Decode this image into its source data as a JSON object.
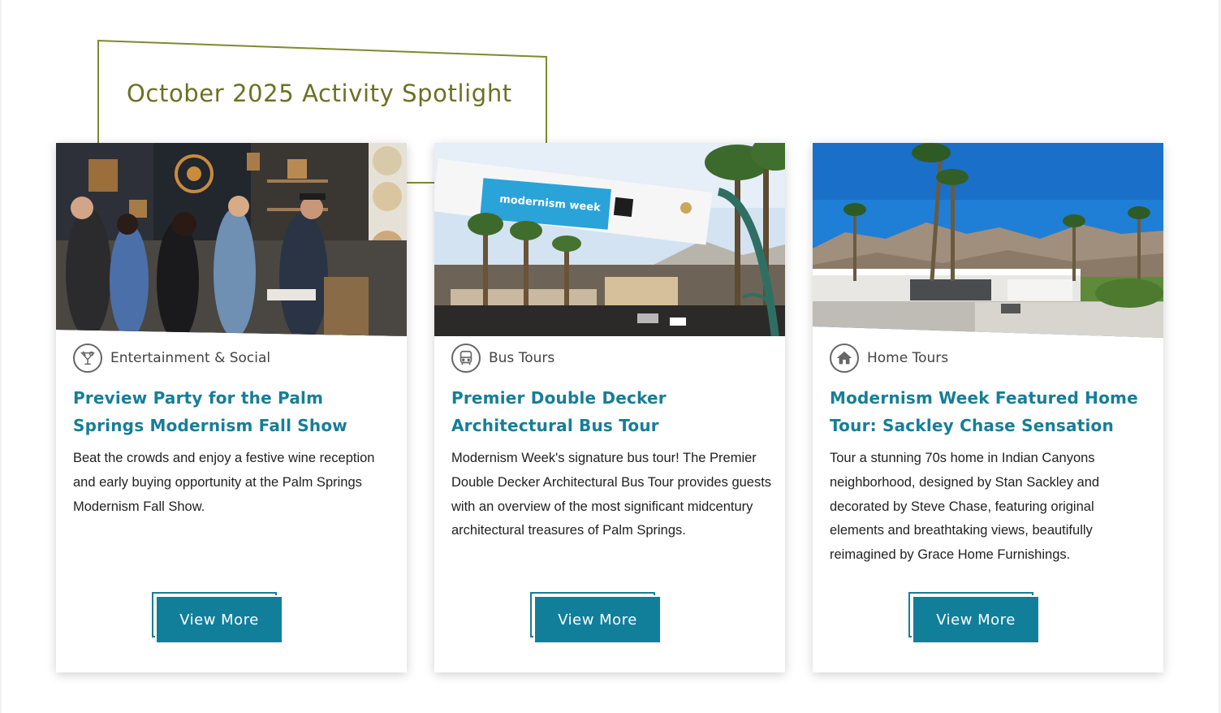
{
  "heading": "October 2025 Activity Spotlight",
  "colors": {
    "heading": "#6a7224",
    "frame": "#7f8a2c",
    "title": "#167e98",
    "button": "#127f9a",
    "category_text": "#444444",
    "body_text": "#222222"
  },
  "cards": [
    {
      "image_name": "preview-party-photo",
      "category_icon": "cocktail-icon",
      "category": "Entertainment & Social",
      "title": "Preview Party for the Palm Springs Modernism Fall Show",
      "description": "Beat the crowds and enjoy a festive wine reception and early buying opportunity at the Palm Springs Modernism Fall Show.",
      "button_label": "View More"
    },
    {
      "image_name": "bus-tour-photo",
      "category_icon": "bus-icon",
      "category": "Bus Tours",
      "title": "Premier Double Decker Architectural Bus Tour",
      "description": "Modernism Week's signature bus tour! The Premier Double Decker Architectural Bus Tour provides guests with an overview of the most significant midcentury architectural treasures of Palm Springs.",
      "button_label": "View More"
    },
    {
      "image_name": "home-tour-photo",
      "category_icon": "house-icon",
      "category": "Home Tours",
      "title": "Modernism Week Featured Home Tour: Sackley Chase Sensation",
      "description": "Tour a stunning 70s home in Indian Canyons neighborhood, designed by Stan Sackley and decorated by Steve Chase, featuring original elements and breathtaking views, beautifully reimagined by Grace Home Furnishings.",
      "button_label": "View More"
    }
  ]
}
